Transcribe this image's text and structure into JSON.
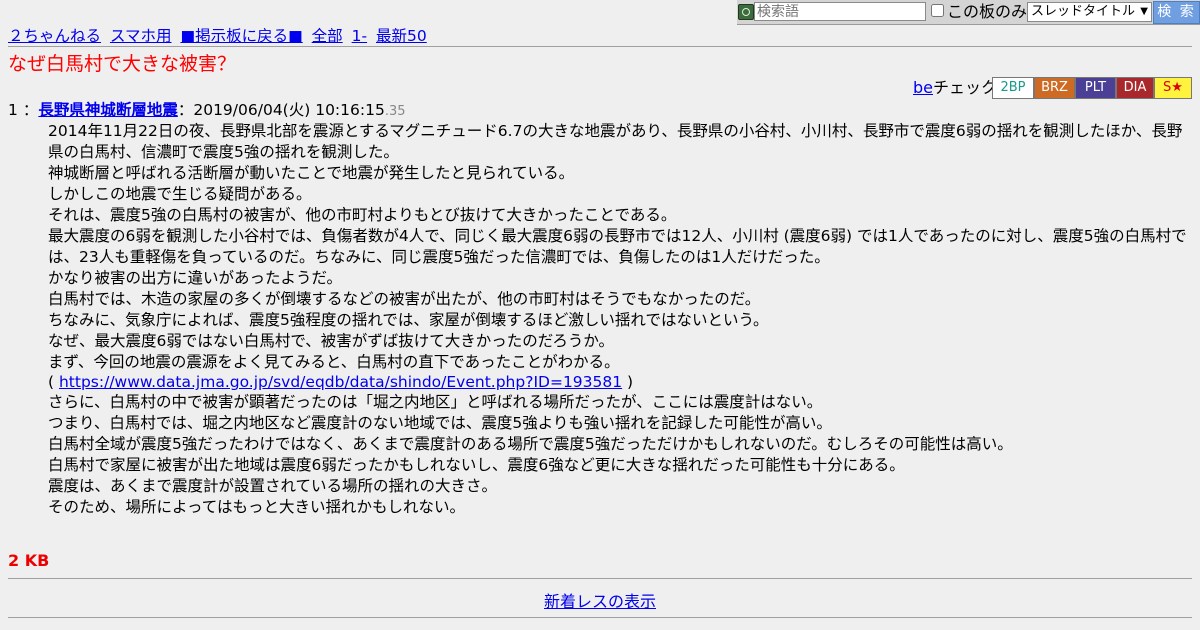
{
  "search": {
    "placeholder": "検索語",
    "board_only_label": "この板のみ",
    "type_selected": "スレッドタイトル",
    "button_label": "検 索"
  },
  "nav": {
    "site": "２ちゃんねる",
    "smartphone": "スマホ用",
    "back_to_board": "■掲示板に戻る■",
    "all": "全部",
    "first": "1-",
    "latest50": "最新50"
  },
  "thread_title": "なぜ白馬村で大きな被害？",
  "becheck": {
    "be_link": "be",
    "label": "チェック",
    "badges": [
      {
        "label": "2BP",
        "bg": "#ffffff",
        "fg": "#1a9a8a"
      },
      {
        "label": "BRZ",
        "bg": "#cd6b24",
        "fg": "#ffffff"
      },
      {
        "label": "PLT",
        "bg": "#4b3f96",
        "fg": "#ffffff"
      },
      {
        "label": "DIA",
        "bg": "#a8282b",
        "fg": "#ffffff"
      },
      {
        "label": "S★",
        "bg": "#fff33d",
        "fg": "#e00000"
      }
    ]
  },
  "post": {
    "number": "1",
    "separator": "：",
    "name": "長野県神城断層地震",
    "date": "：2019/06/04(火) 10:16:15",
    "ms": ".35",
    "lines": [
      "2014年11月22日の夜、長野県北部を震源とするマグニチュード6.7の大きな地震があり、長野県の小谷村、小川村、長野市で震度6弱の揺れを観測したほか、長野県の白馬村、信濃町で震度5強の揺れを観測した。",
      "神城断層と呼ばれる活断層が動いたことで地震が発生したと見られている。",
      "しかしこの地震で生じる疑問がある。",
      "それは、震度5強の白馬村の被害が、他の市町村よりもとび抜けて大きかったことである。",
      "最大震度の6弱を観測した小谷村では、負傷者数が4人で、同じく最大震度6弱の長野市では12人、小川村 (震度6弱) では1人であったのに対し、震度5強の白馬村では、23人も重軽傷を負っているのだ。ちなみに、同じ震度5強だった信濃町では、負傷したのは1人だけだった。",
      "かなり被害の出方に違いがあったようだ。",
      "白馬村では、木造の家屋の多くが倒壊するなどの被害が出たが、他の市町村はそうでもなかったのだ。",
      "ちなみに、気象庁によれば、震度5強程度の揺れでは、家屋が倒壊するほど激しい揺れではないという。",
      "なぜ、最大震度6弱ではない白馬村で、被害がずば抜けて大きかったのだろうか。",
      "まず、今回の地震の震源をよく見てみると、白馬村の直下であったことがわかる。"
    ],
    "link_open": "( ",
    "link_text": "https://www.data.jma.go.jp/svd/eqdb/data/shindo/Event.php?ID=193581",
    "link_close": " )",
    "lines_after": [
      "さらに、白馬村の中で被害が顕著だったのは「堀之内地区」と呼ばれる場所だったが、ここには震度計はない。",
      "つまり、白馬村では、堀之内地区など震度計のない地域では、震度5強よりも強い揺れを記録した可能性が高い。",
      "白馬村全域が震度5強だったわけではなく、あくまで震度計のある場所で震度5強だっただけかもしれないのだ。むしろその可能性は高い。",
      "白馬村で家屋に被害が出た地域は震度6弱だったかもしれないし、震度6強など更に大きな揺れだった可能性も十分にある。",
      "震度は、あくまで震度計が設置されている場所の揺れの大きさ。",
      "そのため、場所によってはもっと大きい揺れかもしれない。"
    ]
  },
  "size_label": "2 KB",
  "new_responses_link": "新着レスの表示"
}
